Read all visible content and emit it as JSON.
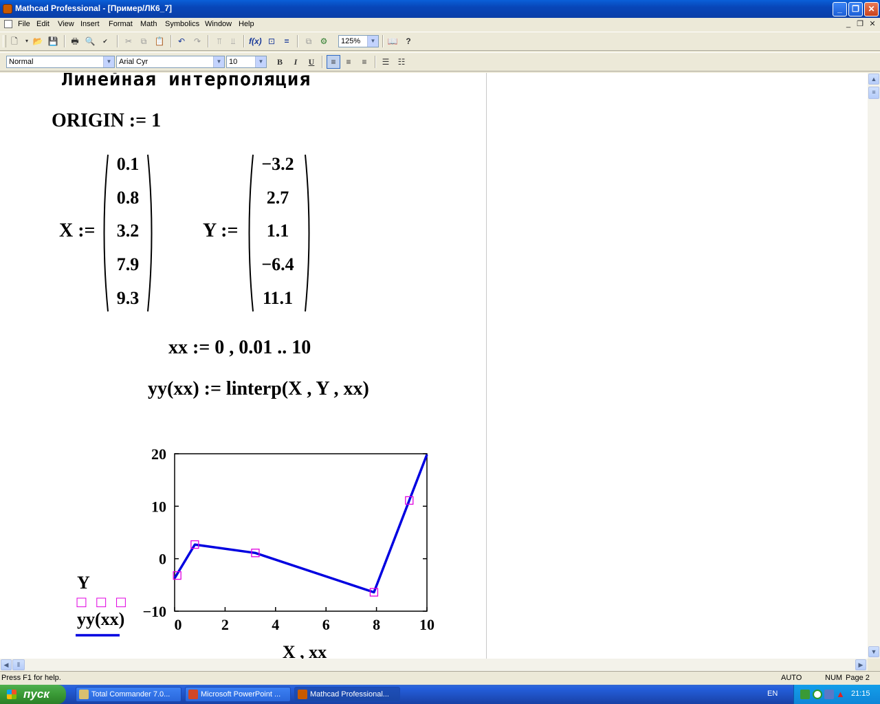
{
  "window": {
    "title": "Mathcad Professional - [Пример/ЛК6_7]"
  },
  "menu": {
    "items": [
      "File",
      "Edit",
      "View",
      "Insert",
      "Format",
      "Math",
      "Symbolics",
      "Window",
      "Help"
    ]
  },
  "toolbar": {
    "zoom": "125%"
  },
  "format_toolbar": {
    "style": "Normal",
    "font": "Arial Cyr",
    "size": "10",
    "bold": "B",
    "italic": "I",
    "underline": "U"
  },
  "worksheet": {
    "heading": "Линейная интерполяция",
    "origin": "ORIGIN := 1",
    "x_label": "X :=",
    "x_values": [
      "0.1",
      "0.8",
      "3.2",
      "7.9",
      "9.3"
    ],
    "y_label": "Y :=",
    "y_values": [
      "−3.2",
      "2.7",
      "1.1",
      "−6.4",
      "11.1"
    ],
    "range_def": "xx := 0 , 0.01 .. 10",
    "func_def": "yy(xx) := linterp(X , Y , xx)"
  },
  "chart_data": {
    "type": "line",
    "xlabel": "X , xx",
    "xlim": [
      0,
      10
    ],
    "ylim": [
      -10,
      20
    ],
    "x_ticks": [
      "0",
      "2",
      "4",
      "6",
      "8",
      "10"
    ],
    "y_ticks": [
      "20",
      "10",
      "0",
      "−10"
    ],
    "series": [
      {
        "name": "Y",
        "style": "markers",
        "color": "#e000e0",
        "x": [
          0.1,
          0.8,
          3.2,
          7.9,
          9.3
        ],
        "y": [
          -3.2,
          2.7,
          1.1,
          -6.4,
          11.1
        ]
      },
      {
        "name": "yy(xx)",
        "style": "line",
        "color": "#0000e0",
        "x": [
          0,
          0.8,
          3.2,
          7.9,
          10
        ],
        "y": [
          -3.71,
          2.7,
          1.1,
          -6.4,
          19.85
        ]
      }
    ],
    "legend_markers": "□ □ □"
  },
  "statusbar": {
    "help": "Press F1 for help.",
    "mode": "AUTO",
    "num": "NUM",
    "page": "Page 2"
  },
  "taskbar": {
    "start": "пуск",
    "tasks": [
      "Total Commander 7.0...",
      "Microsoft PowerPoint ...",
      "Mathcad Professional..."
    ],
    "lang": "EN",
    "clock": "21:15"
  }
}
